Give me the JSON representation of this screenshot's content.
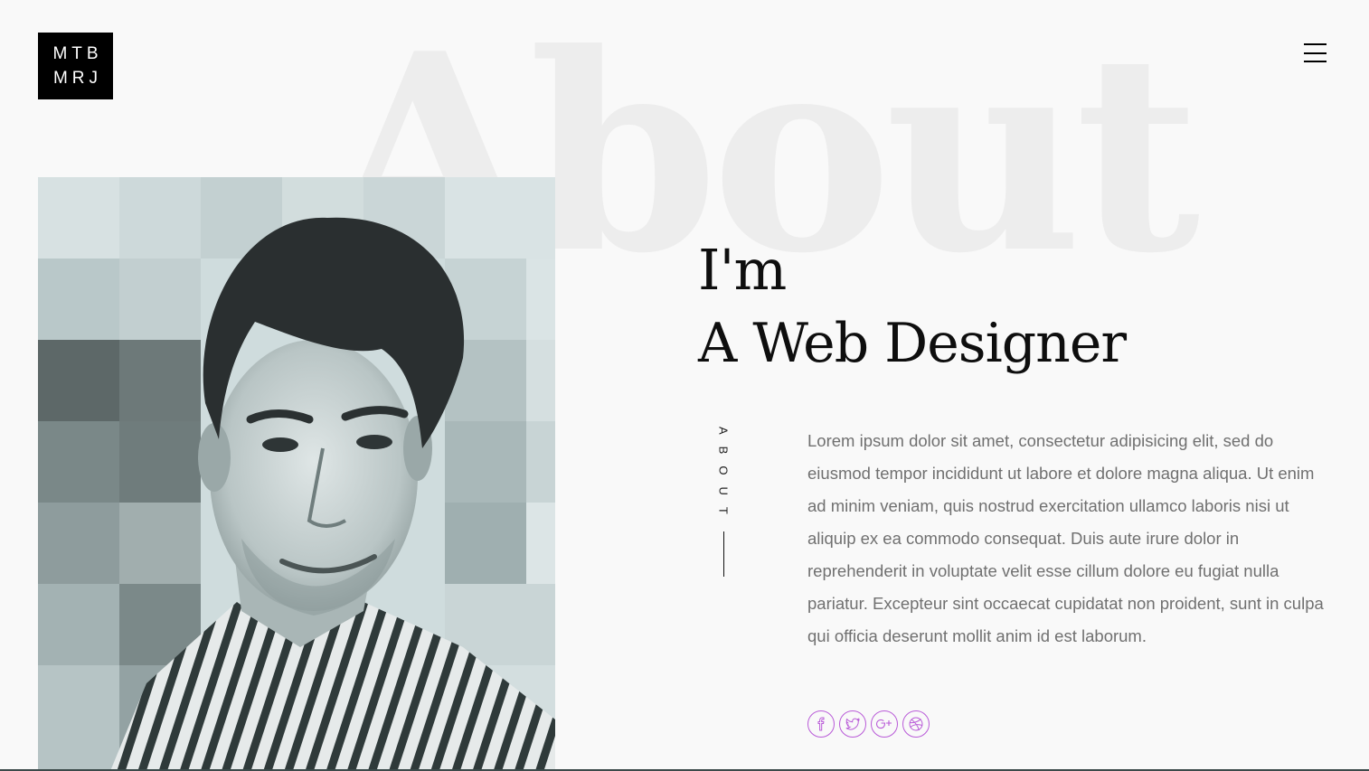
{
  "background_word": "About",
  "logo": {
    "line1": "MTB",
    "line2": "MRJ"
  },
  "menu": {
    "icon": "hamburger-menu-icon"
  },
  "headline": {
    "line1": "I'm",
    "line2": "A Web Designer"
  },
  "side_label": "ABOUT",
  "bio": "Lorem ipsum dolor sit amet, consectetur adipisicing elit, sed do eiusmod tempor incididunt ut labore et dolore magna aliqua. Ut enim ad minim veniam, quis nostrud exercitation ullamco laboris nisi ut aliquip ex ea commodo consequat. Duis aute irure dolor in reprehenderit in voluptate velit esse cillum dolore eu fugiat nulla pariatur. Excepteur sint occaecat cupidatat non proident, sunt in culpa qui officia deserunt mollit anim id est laborum.",
  "socials": [
    {
      "icon": "facebook-icon"
    },
    {
      "icon": "twitter-icon"
    },
    {
      "icon": "google-plus-icon"
    },
    {
      "icon": "dribbble-icon"
    }
  ],
  "colors": {
    "accent": "#b95bd8",
    "background": "#f9f9f9",
    "logo_bg": "#000000",
    "bio_text": "#707070"
  }
}
